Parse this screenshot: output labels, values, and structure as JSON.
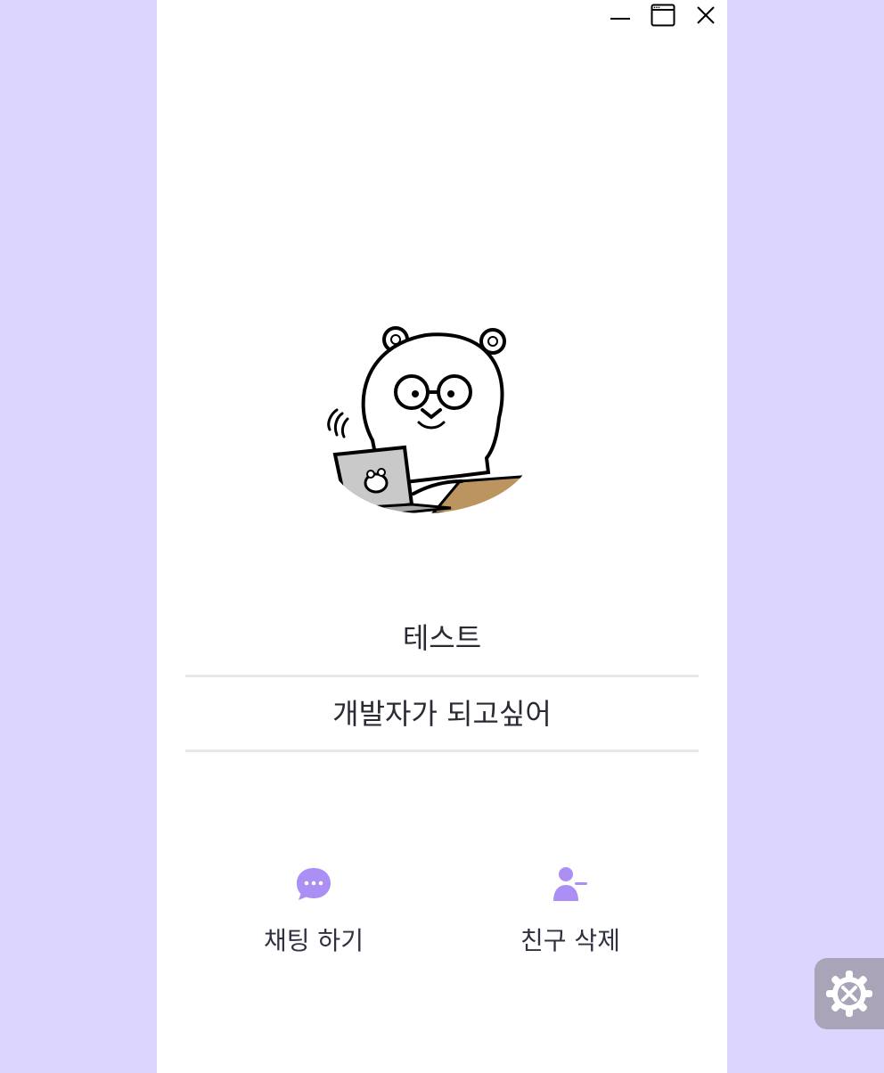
{
  "window": {
    "controls": {
      "minimize_icon": "minimize-icon",
      "maximize_icon": "maximize-icon",
      "close_icon": "close-icon"
    }
  },
  "profile": {
    "avatar_icon": "bear-typing-laptop-avatar",
    "name": "테스트",
    "status_message": "개발자가 되고싶어"
  },
  "actions": [
    {
      "label": "채팅 하기",
      "icon": "chat-bubble-icon"
    },
    {
      "label": "친구 삭제",
      "icon": "remove-friend-icon"
    }
  ],
  "settings_fab": {
    "icon": "settings-gear-icon"
  },
  "colors": {
    "background": "#dcd6fe",
    "accent": "#ab8ff5",
    "divider": "#e7e7e7",
    "text": "#2a2a35"
  }
}
